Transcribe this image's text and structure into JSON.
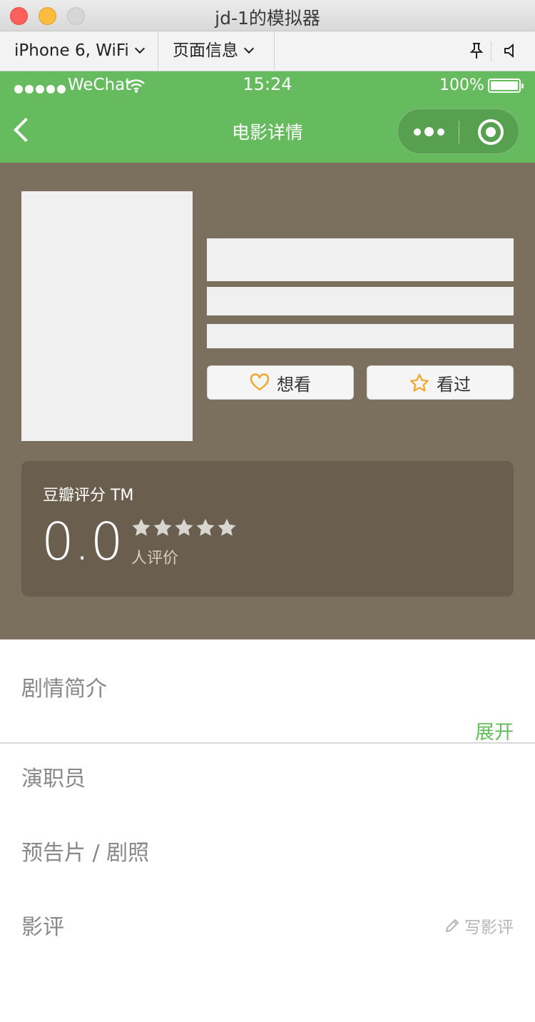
{
  "window": {
    "title": "jd-1的模拟器"
  },
  "toolbar": {
    "device": "iPhone 6, WiFi",
    "page_info": "页面信息"
  },
  "status_bar": {
    "carrier": "WeChat",
    "time": "15:24",
    "battery": "100%"
  },
  "nav": {
    "title": "电影详情"
  },
  "movie": {
    "want_label": "想看",
    "seen_label": "看过",
    "rating_source": "豆瓣评分 TM",
    "score": "0.0",
    "stars": 0,
    "review_count_label": "人评价"
  },
  "sections": {
    "synopsis": "剧情简介",
    "expand": "展开",
    "cast": "演职员",
    "trailers": "预告片 / 剧照",
    "reviews": "影评",
    "write_review": "写影评"
  },
  "colors": {
    "wechat_green": "#66bb5e",
    "hero_bg": "#7b6f5d",
    "rating_bg": "#6a5f4f",
    "accent_orange": "#f0a830"
  }
}
